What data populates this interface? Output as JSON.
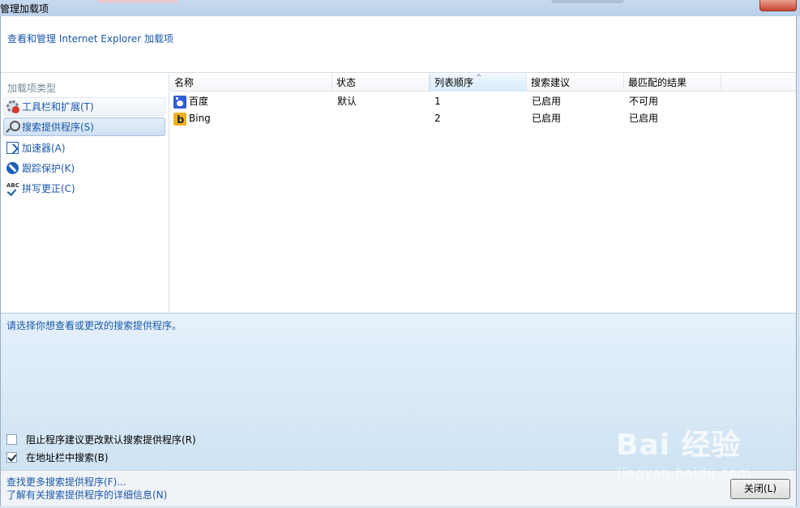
{
  "window": {
    "title": "管理加载项"
  },
  "header": {
    "text": "查看和管理 Internet Explorer 加载项"
  },
  "sidebar": {
    "label": "加载项类型",
    "items": [
      {
        "label": "工具栏和扩展(T)",
        "icon": "gear-icon"
      },
      {
        "label": "搜索提供程序(S)",
        "icon": "search-icon"
      },
      {
        "label": "加速器(A)",
        "icon": "accelerator-icon"
      },
      {
        "label": "跟踪保护(K)",
        "icon": "tracking-protection-icon"
      },
      {
        "label": "拼写更正(C)",
        "icon": "spelling-icon"
      }
    ]
  },
  "table": {
    "columns": [
      "名称",
      "状态",
      "列表顺序",
      "搜索建议",
      "最匹配的结果"
    ],
    "sort_indicator": "^",
    "rows": [
      {
        "name": "百度",
        "status": "默认",
        "order": "1",
        "suggestions": "已启用",
        "top_result": "不可用",
        "icon": "baidu-logo-icon"
      },
      {
        "name": "Bing",
        "status": "",
        "order": "2",
        "suggestions": "已启用",
        "top_result": "已启用",
        "icon": "bing-logo-icon"
      }
    ]
  },
  "details": {
    "text": "请选择你想查看或更改的搜索提供程序。",
    "checkbox_prevent": {
      "label": "阻止程序建议更改默认搜索提供程序(R)",
      "checked": false
    },
    "checkbox_addressbar": {
      "label": "在地址栏中搜索(B)",
      "checked": true
    }
  },
  "footer": {
    "link_more": "查找更多搜索提供程序(F)...",
    "link_info": "了解有关搜索提供程序的详细信息(N)",
    "close_label": "关闭(L)"
  },
  "watermark": {
    "main": "Bai 经验",
    "sub": "jingyan.baidu.com"
  },
  "colors": {
    "link": "#1b58a8",
    "selected": "#cfe0f3",
    "details_bg": "#dcebf7"
  }
}
